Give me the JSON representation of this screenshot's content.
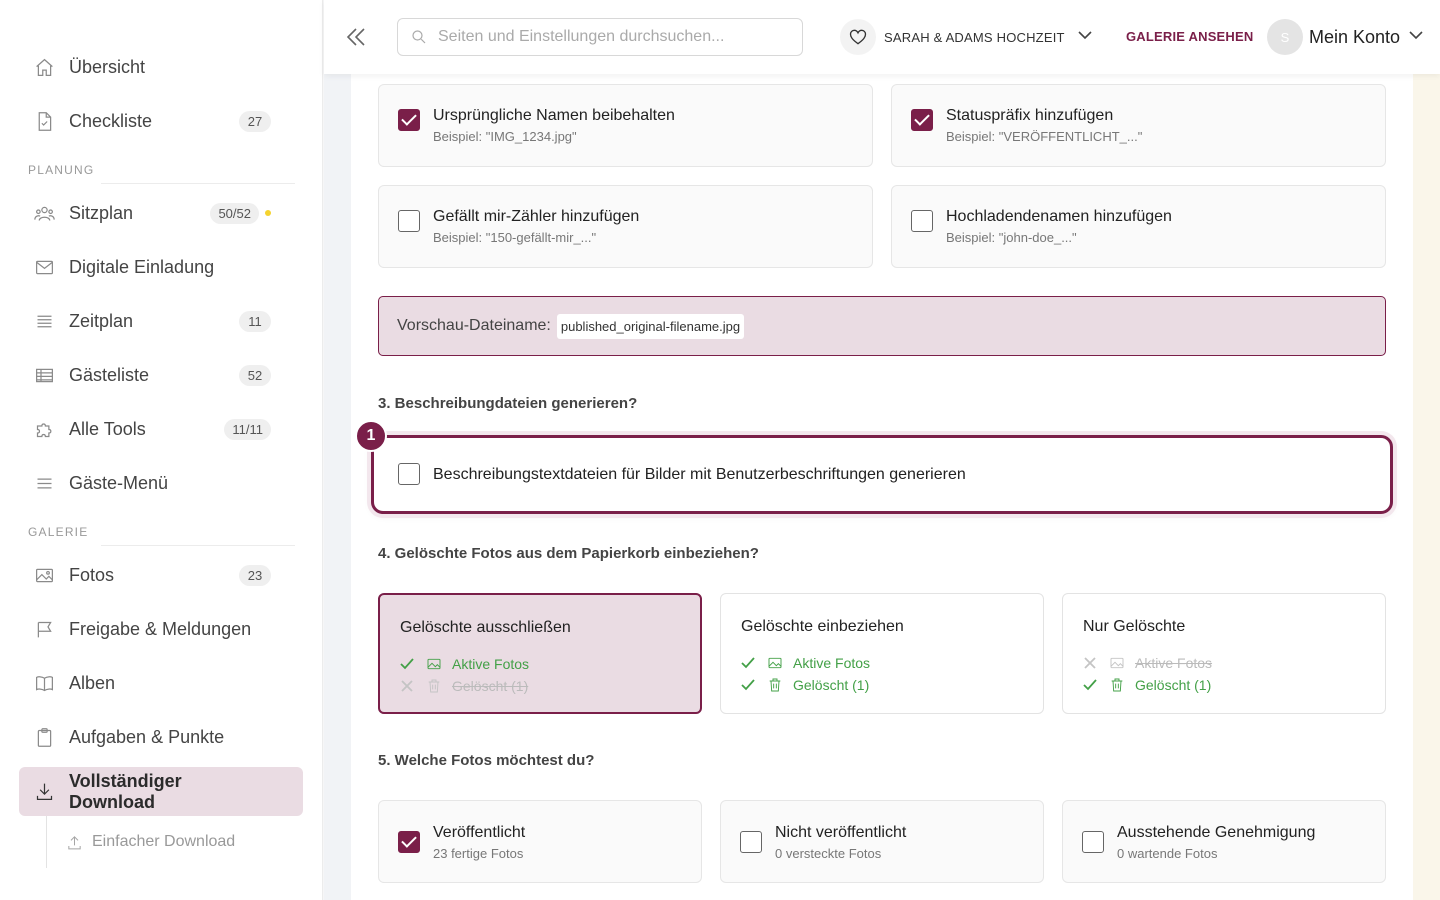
{
  "sidebar": {
    "items_top": [
      {
        "label": "Übersicht",
        "badge": ""
      },
      {
        "label": "Checkliste",
        "badge": "27"
      }
    ],
    "section_planung": "PLANUNG",
    "items_planung": [
      {
        "label": "Sitzplan",
        "badge": "50/52"
      },
      {
        "label": "Digitale Einladung",
        "badge": ""
      },
      {
        "label": "Zeitplan",
        "badge": "11"
      },
      {
        "label": "Gästeliste",
        "badge": "52"
      },
      {
        "label": "Alle Tools",
        "badge": "11/11"
      },
      {
        "label": "Gäste-Menü",
        "badge": ""
      }
    ],
    "section_galerie": "GALERIE",
    "items_galerie": [
      {
        "label": "Fotos",
        "badge": "23"
      },
      {
        "label": "Freigabe & Meldungen",
        "badge": ""
      },
      {
        "label": "Alben",
        "badge": ""
      },
      {
        "label": "Aufgaben & Punkte",
        "badge": ""
      },
      {
        "label": "Vollständiger Download",
        "badge": ""
      }
    ],
    "sub_item": "Einfacher Download",
    "dot_color": "#f5d32e"
  },
  "header": {
    "search_placeholder": "Seiten und Einstellungen durchsuchen...",
    "event_name": "SARAH & ADAMS HOCHZEIT",
    "gallery_link": "GALERIE ANSEHEN",
    "avatar_initial": "S",
    "account_label": "Mein Konto"
  },
  "options": [
    {
      "title": "Ursprüngliche Namen beibehalten",
      "example": "Beispiel: \"IMG_1234.jpg\"",
      "checked": true
    },
    {
      "title": "Statuspräfix hinzufügen",
      "example": "Beispiel: \"VERÖFFENTLICHT_...\"",
      "checked": true
    },
    {
      "title": "Gefällt mir-Zähler hinzufügen",
      "example": "Beispiel: \"150-gefällt-mir_...\"",
      "checked": false
    },
    {
      "title": "Hochladendenamen hinzufügen",
      "example": "Beispiel: \"john-doe_...\"",
      "checked": false
    }
  ],
  "preview": {
    "label": "Vorschau-Dateiname:",
    "value": "published_original-filename.jpg"
  },
  "q3": {
    "title": "3. Beschreibungdateien generieren?",
    "step": "1",
    "option": "Beschreibungstextdateien für Bilder mit Benutzerbeschriftungen generieren"
  },
  "q4": {
    "title": "4. Gelöschte Fotos aus dem Papierkorb einbeziehen?",
    "cards": [
      {
        "title": "Gelöschte ausschließen",
        "active": "Aktive Fotos",
        "deleted": "Gelöscht (1)"
      },
      {
        "title": "Gelöschte einbeziehen",
        "active": "Aktive Fotos",
        "deleted": "Gelöscht (1)"
      },
      {
        "title": "Nur Gelöschte",
        "active": "Aktive Fotos",
        "deleted": "Gelöscht (1)"
      }
    ]
  },
  "q5": {
    "title": "5. Welche Fotos möchtest du?",
    "cards": [
      {
        "title": "Veröffentlicht",
        "sub": "23 fertige Fotos",
        "checked": true
      },
      {
        "title": "Nicht veröffentlicht",
        "sub": "0 versteckte Fotos",
        "checked": false
      },
      {
        "title": "Ausstehende Genehmigung",
        "sub": "0 wartende Fotos",
        "checked": false
      }
    ]
  },
  "accent_color": "#7a1f49"
}
